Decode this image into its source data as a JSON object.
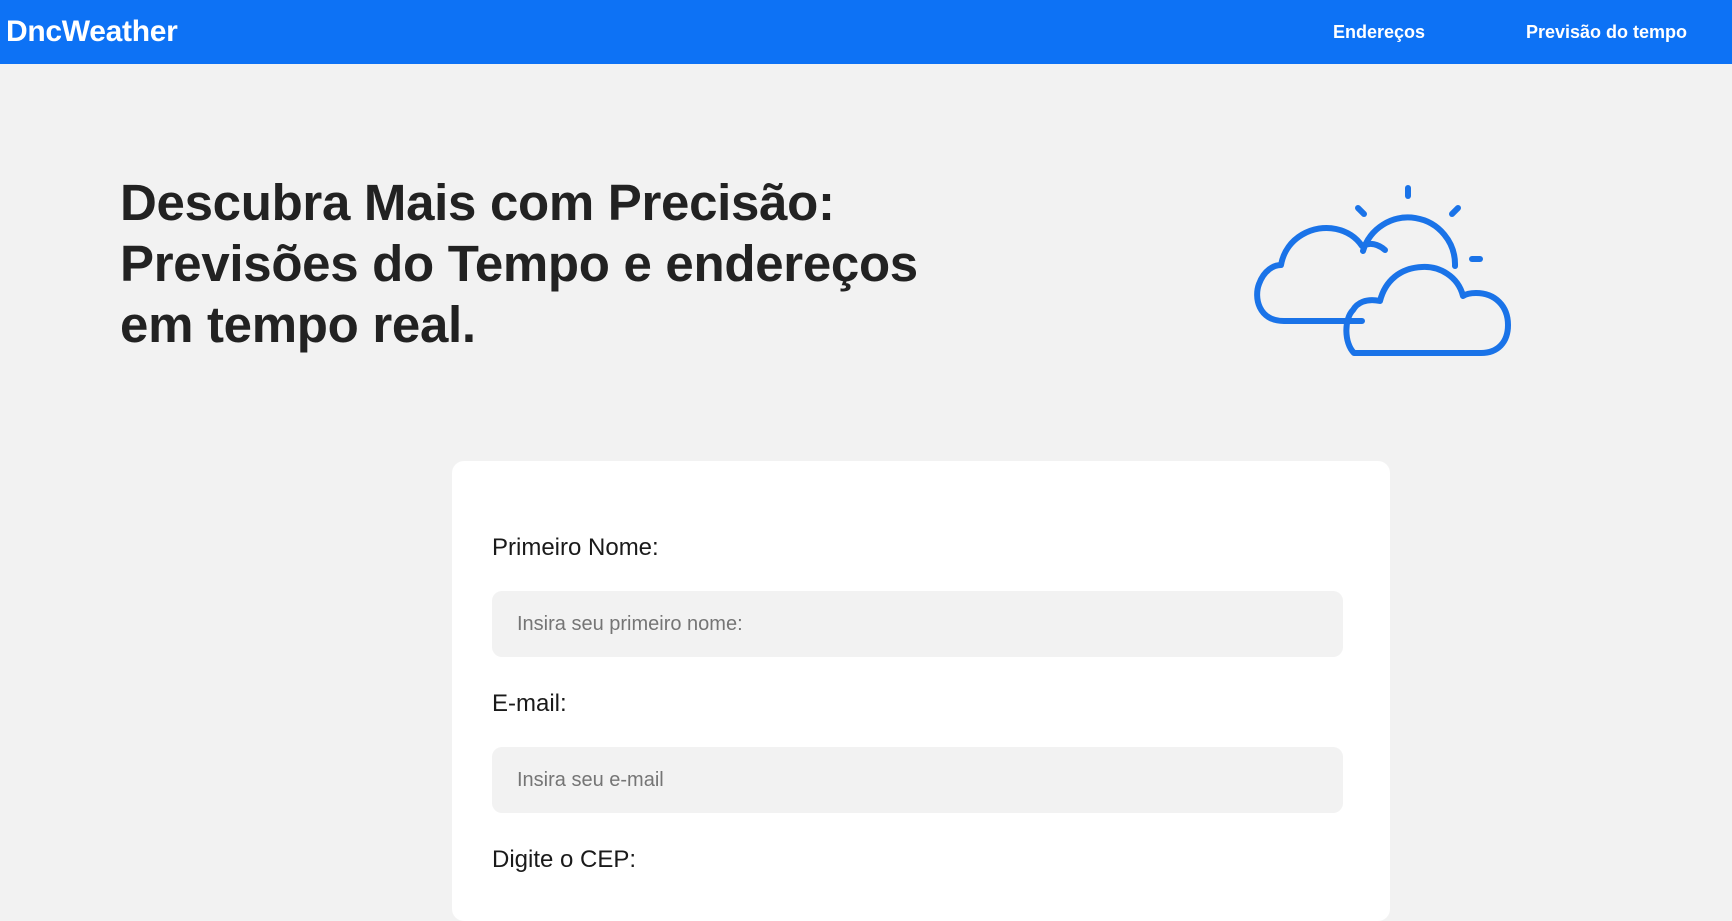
{
  "header": {
    "brand": "DncWeather",
    "nav": {
      "addresses": "Endereços",
      "forecast": "Previsão do tempo"
    },
    "background_color": "#0d72f5"
  },
  "hero": {
    "title": "Descubra Mais com Precisão: Previsões do Tempo e endereços em tempo real.",
    "illustration_icon": "cloud-sun-icon",
    "illustration_color": "#1a73e8"
  },
  "form": {
    "first_name": {
      "label": "Primeiro Nome:",
      "placeholder": "Insira seu primeiro nome:",
      "value": ""
    },
    "email": {
      "label": "E-mail:",
      "placeholder": "Insira seu e-mail",
      "value": ""
    },
    "cep": {
      "label": "Digite o CEP:"
    }
  }
}
